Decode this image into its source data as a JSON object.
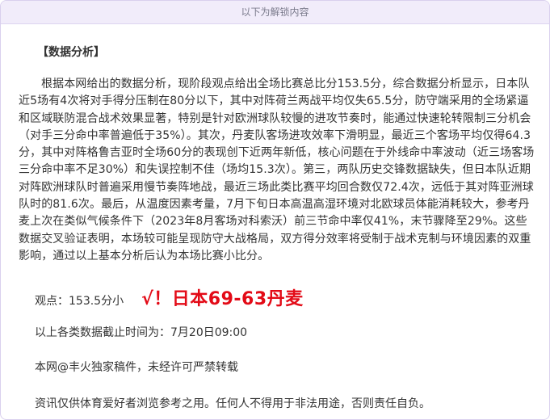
{
  "unlock_banner": "以下为解锁内容",
  "section_title": "【数据分析】",
  "analysis_paragraph": "根据本网给出的数据分析，现阶段观点给出全场比赛总比分153.5分，综合数据分析显示，日本队近5场有4次将对手得分压制在80分以下，其中对阵荷兰两战平均仅失65.5分，防守端采用的全场紧逼和区域联防混合战术效果显著，特别是针对欧洲球队较慢的进攻节奏时，能通过快速轮转限制三分机会（对手三分命中率普遍低于35%）。其次，丹麦队客场进攻效率下滑明显，最近三个客场平均仅得64.3分，其中对阵格鲁吉亚时全场60分的表现创下近两年新低，核心问题在于外线命中率波动（近三场客场三分命中率不足30%）和失误控制不佳（场均15.3次）。第三，两队历史交锋数据缺失，但日本队近期对阵欧洲球队时普遍采用慢节奏阵地战，最近三场此类比赛平均回合数仅72.4次，远低于其对阵亚洲球队时的81.6次。最后，从温度因素考量，7月下旬日本高温高湿环境对北欧球员体能消耗较大，参考丹麦上次在类似气候条件下（2023年8月客场对科索沃）前三节命中率仅41%，末节骤降至29%。这些数据交叉验证表明，本场较可能呈现防守大战格局，双方得分效率将受制于战术克制与环境因素的双重影响，通过以上基本分析后认为本场比赛小比分。",
  "opinion": {
    "text": "观点：153.5分小",
    "result": "√！日本69-63丹麦"
  },
  "deadline": "以上各类数据截止时间为：7月20日09:00",
  "copyright": "本网@丰火独家稿件，未经许可严禁转载",
  "disclaimer": "资讯仅供体育爱好者浏览参考之用。任何人不得用于非法用途，否则责任自负。",
  "colors": {
    "banner_bg": "#f1ecfa",
    "result_red": "#e30b17",
    "text": "#333333"
  }
}
